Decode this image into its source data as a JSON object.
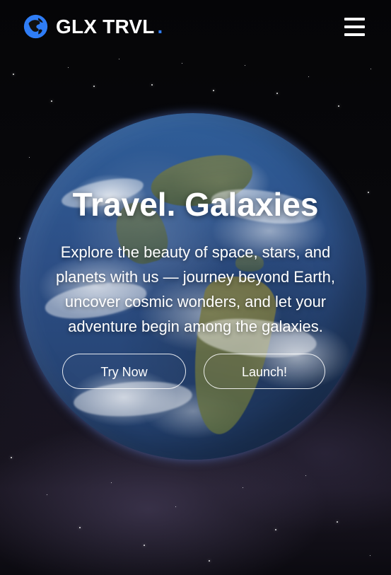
{
  "header": {
    "brand": "GLX TRVL",
    "brand_dot": ".",
    "logo_icon": "globe-icon",
    "menu_icon": "hamburger-icon"
  },
  "hero": {
    "title": "Travel. Galaxies",
    "description": "Explore the beauty of space, stars, and planets with us — journey beyond Earth, uncover cosmic wonders, and let your adventure begin among the galaxies."
  },
  "actions": {
    "primary": "Try Now",
    "secondary": "Launch!"
  },
  "colors": {
    "accent": "#2f7df6",
    "text": "#ffffff",
    "background": "#07070b"
  }
}
